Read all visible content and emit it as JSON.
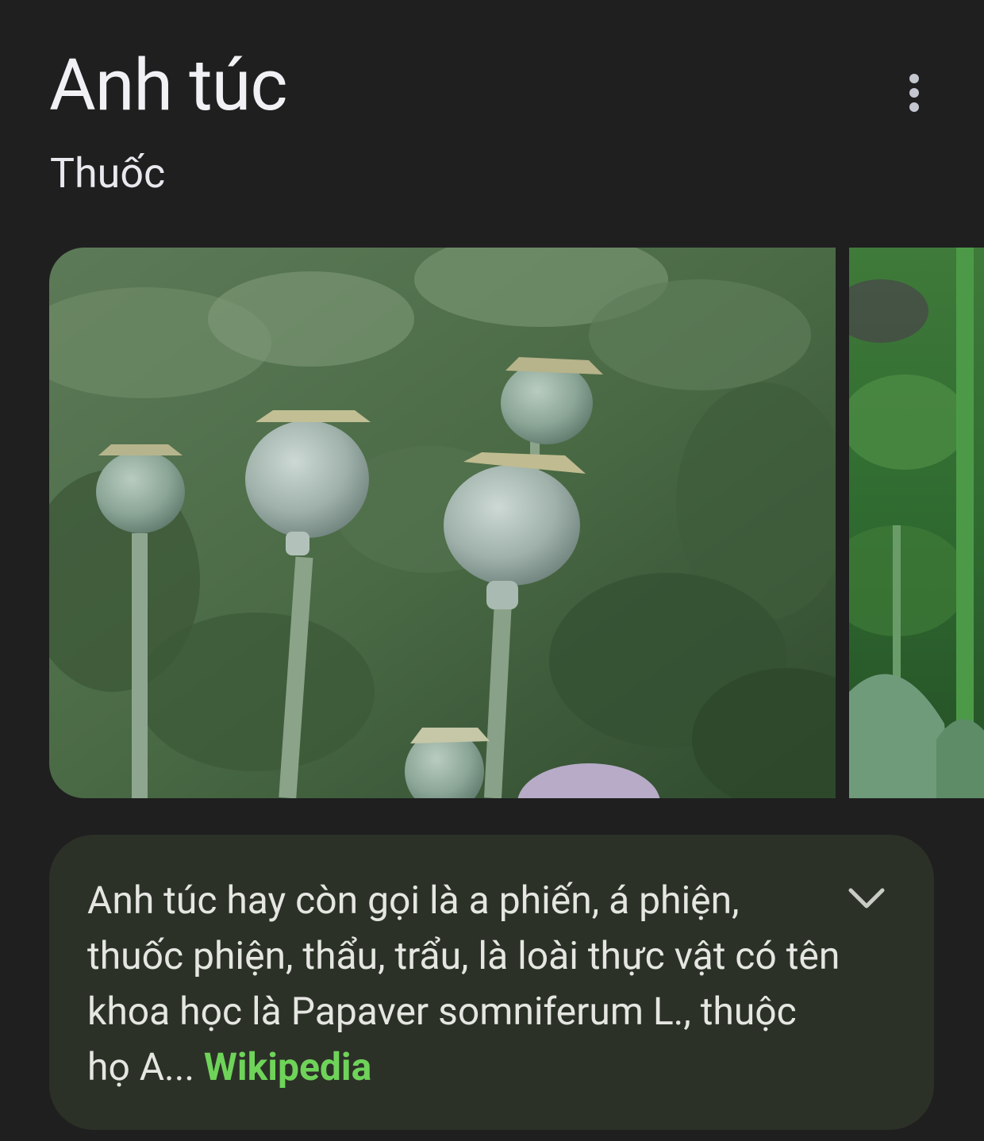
{
  "header": {
    "title": "Anh túc",
    "subtitle": "Thuốc",
    "menu_icon": "more-vert-icon"
  },
  "images": [
    {
      "subject": "poppy-seed-pods"
    },
    {
      "subject": "poppy-plant-stems"
    }
  ],
  "description": {
    "text": "Anh túc hay còn gọi là a phiến, á phiện, thuốc phiện, thẩu, trẩu, là loài thực vật có tên khoa học là Papaver somniferum L., thuộc họ A...",
    "source_label": "Wikipedia",
    "expand_icon": "chevron-down-icon"
  },
  "colors": {
    "background": "#1f1f1f",
    "card_background": "#2c3128",
    "link_green": "#6fd35a"
  }
}
